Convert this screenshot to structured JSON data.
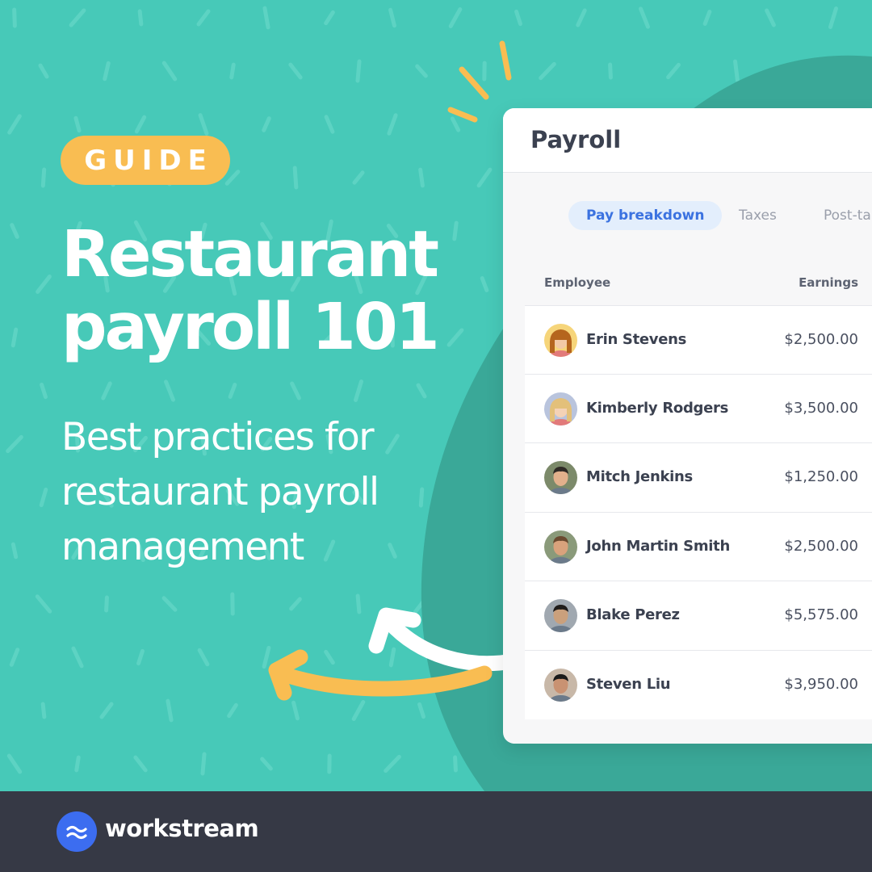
{
  "colors": {
    "background": "#47c9b8",
    "blob": "#3aa898",
    "accent_yellow": "#f9bd52",
    "tab_active_bg": "#e3eefc",
    "tab_active_text": "#3b72e0",
    "footer": "#363945",
    "brand_blue": "#3c6df0"
  },
  "badge": {
    "label": "GUIDE"
  },
  "headline": {
    "line1": "Restaurant",
    "line2": "payroll 101"
  },
  "subhead": {
    "line1": "Best practices for",
    "line2": "restaurant payroll",
    "line3": "management"
  },
  "card": {
    "title": "Payroll",
    "tabs": [
      {
        "label": "Pay breakdown",
        "active": true
      },
      {
        "label": "Taxes",
        "active": false
      },
      {
        "label": "Post-ta",
        "active": false
      }
    ],
    "columns": {
      "employee": "Employee",
      "earnings": "Earnings"
    },
    "rows": [
      {
        "name": "Erin Stevens",
        "earnings": "$2,500.00",
        "avatar_icon": "woman-avatar-icon"
      },
      {
        "name": "Kimberly Rodgers",
        "earnings": "$3,500.00",
        "avatar_icon": "woman-avatar-icon"
      },
      {
        "name": "Mitch Jenkins",
        "earnings": "$1,250.00",
        "avatar_icon": "man-avatar-icon"
      },
      {
        "name": "John Martin Smith",
        "earnings": "$2,500.00",
        "avatar_icon": "man-avatar-icon"
      },
      {
        "name": "Blake Perez",
        "earnings": "$5,575.00",
        "avatar_icon": "man-avatar-icon"
      },
      {
        "name": "Steven Liu",
        "earnings": "$3,950.00",
        "avatar_icon": "man-avatar-icon"
      }
    ]
  },
  "footer": {
    "brand": "workstream",
    "logo_icon": "wave-logo-icon"
  }
}
